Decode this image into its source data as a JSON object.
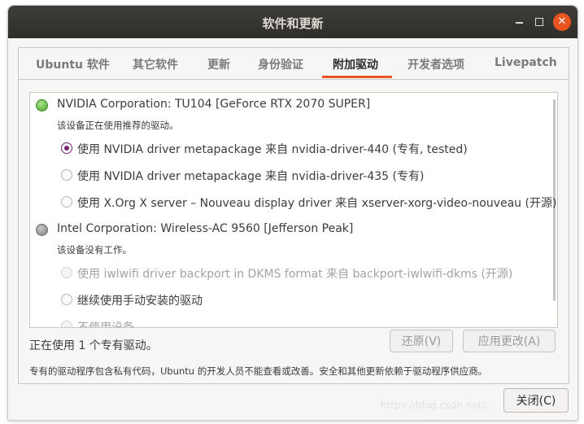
{
  "window": {
    "title": "软件和更新"
  },
  "tabs": [
    {
      "label": "Ubuntu 软件"
    },
    {
      "label": "其它软件"
    },
    {
      "label": "更新"
    },
    {
      "label": "身份验证"
    },
    {
      "label": "附加驱动"
    },
    {
      "label": "开发者选项"
    },
    {
      "label": "Livepatch"
    }
  ],
  "active_tab": "附加驱动",
  "devices": [
    {
      "name": "NVIDIA Corporation: TU104 [GeForce RTX 2070 SUPER]",
      "status_color": "green",
      "status": "该设备正在使用推荐的驱动。",
      "options": [
        {
          "label": "使用 NVIDIA driver metapackage 来自 nvidia-driver-440 (专有, tested)",
          "selected": true,
          "enabled": true
        },
        {
          "label": "使用 NVIDIA driver metapackage 来自 nvidia-driver-435 (专有)",
          "selected": false,
          "enabled": true
        },
        {
          "label": "使用 X.Org X server – Nouveau display driver 来自 xserver-xorg-video-nouveau (开源)",
          "selected": false,
          "enabled": true
        }
      ]
    },
    {
      "name": "Intel Corporation: Wireless-AC 9560 [Jefferson Peak]",
      "status_color": "gray",
      "status": "该设备没有工作。",
      "options": [
        {
          "label": "使用 iwlwifi driver backport in DKMS format 来自 backport-iwlwifi-dkms (开源)",
          "selected": false,
          "enabled": false
        },
        {
          "label": "继续使用手动安装的驱动",
          "selected": false,
          "enabled": true
        },
        {
          "label": "不使用设备",
          "selected": true,
          "enabled": false
        }
      ]
    }
  ],
  "footer": {
    "summary": "正在使用 1 个专有驱动。",
    "revert_label": "还原(V)",
    "apply_label": "应用更改(A)",
    "note": "专有的驱动程序包含私有代码，Ubuntu 的开发人员不能查看或改善。安全和其他更新依赖于驱动程序供应商。"
  },
  "close_label": "关闭(C)",
  "watermark": "https://blog.csdn.net/..."
}
